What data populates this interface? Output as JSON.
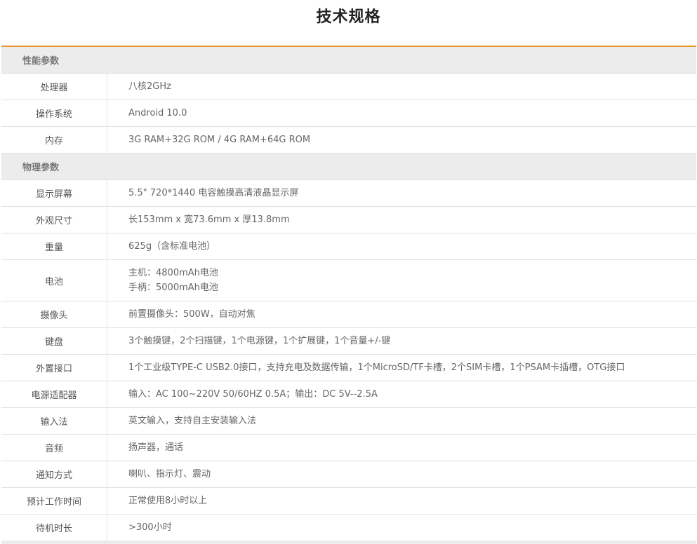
{
  "page": {
    "title": "技术规格",
    "accent_color": "#e8962a"
  },
  "sections": [
    {
      "label": "性能参数",
      "rows": [
        {
          "label": "处理器",
          "values": [
            "八核2GHz"
          ]
        },
        {
          "label": "操作系统",
          "values": [
            "Android 10.0"
          ]
        },
        {
          "label": "内存",
          "values": [
            "3G RAM+32G ROM / 4G RAM+64G ROM"
          ]
        }
      ]
    },
    {
      "label": "物理参数",
      "rows": [
        {
          "label": "显示屏幕",
          "values": [
            "5.5\" 720*1440 电容触摸高清液晶显示屏"
          ]
        },
        {
          "label": "外观尺寸",
          "values": [
            "长153mm x 宽73.6mm x 厚13.8mm"
          ]
        },
        {
          "label": "重量",
          "values": [
            "625g（含标准电池）"
          ]
        },
        {
          "label": "电池",
          "values": [
            "主机：4800mAh电池",
            "手柄：5000mAh电池"
          ]
        },
        {
          "label": "摄像头",
          "values": [
            "前置摄像头：500W，自动对焦"
          ]
        },
        {
          "label": "键盘",
          "values": [
            "3个触摸键，2个扫描键，1个电源键，1个扩展键，1个音量+/-键"
          ]
        },
        {
          "label": "外置接口",
          "values": [
            "1个工业级TYPE-C USB2.0接口，支持充电及数据传输，1个MicroSD/TF卡槽，2个SIM卡槽，1个PSAM卡插槽，OTG接口"
          ]
        },
        {
          "label": "电源适配器",
          "values": [
            "输入：AC 100~220V 50/60HZ 0.5A；输出：DC 5V--2.5A"
          ]
        },
        {
          "label": "输入法",
          "values": [
            "英文输入，支持自主安装输入法"
          ]
        },
        {
          "label": "音频",
          "values": [
            "扬声器，通话"
          ]
        },
        {
          "label": "通知方式",
          "values": [
            "喇叭、指示灯、震动"
          ]
        },
        {
          "label": "预计工作时间",
          "values": [
            "正常使用8小时以上"
          ]
        },
        {
          "label": "待机时长",
          "values": [
            ">300小时"
          ]
        }
      ]
    }
  ]
}
